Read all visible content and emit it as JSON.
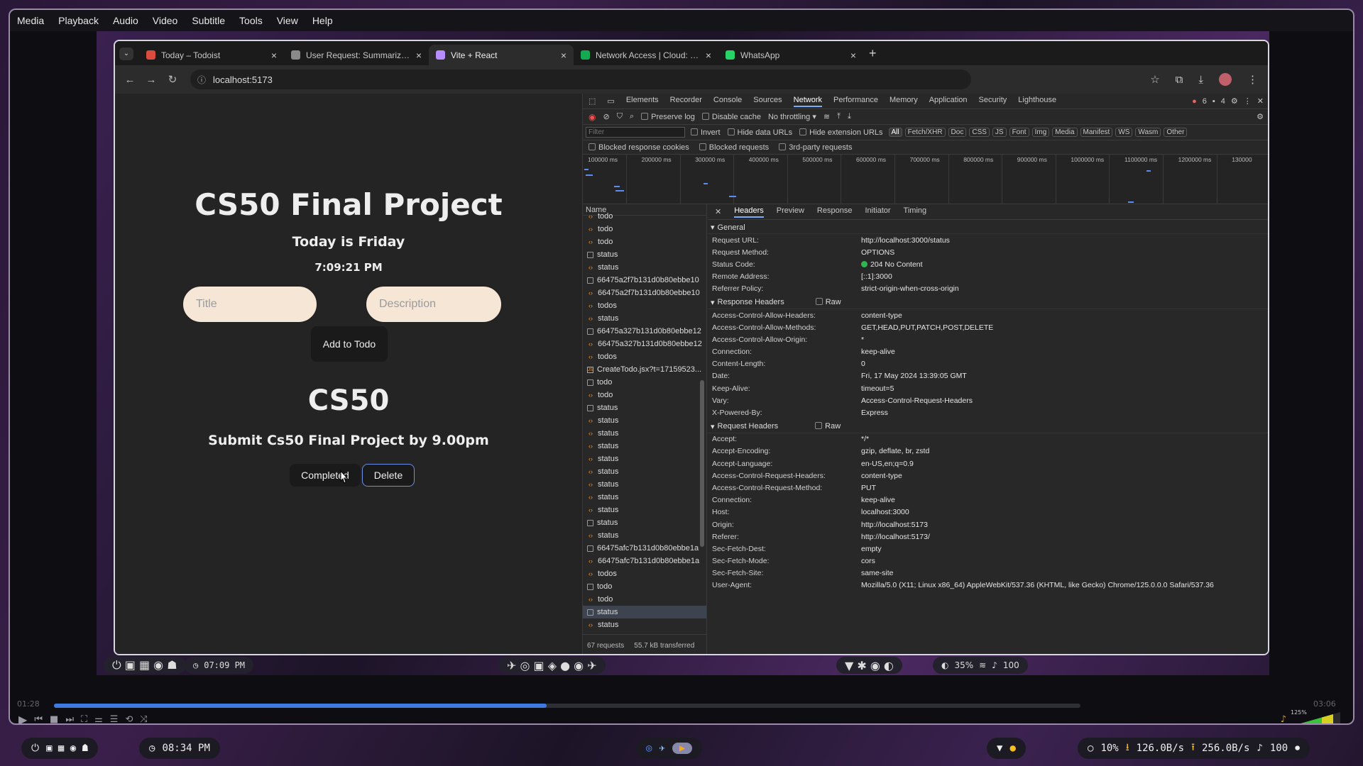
{
  "vlc": {
    "menu": [
      "Media",
      "Playback",
      "Audio",
      "Video",
      "Subtitle",
      "Tools",
      "View",
      "Help"
    ],
    "time_elapsed": "01:28",
    "time_total": "03:06",
    "progress": 0.48,
    "volume_percent": "125%",
    "inner_dock": {
      "clock": "07:09 PM",
      "brightness": "35%",
      "volume": "100"
    }
  },
  "browser": {
    "tabs": [
      {
        "title": "Today – Todoist",
        "color": "#db4c3f"
      },
      {
        "title": "User Request: Summarize Co",
        "color": "#8a8a8a"
      },
      {
        "title": "Vite + React",
        "color": "#b78cff"
      },
      {
        "title": "Network Access | Cloud: Mon",
        "color": "#13aa52"
      },
      {
        "title": "WhatsApp",
        "color": "#25d366"
      }
    ],
    "active_tab": 2,
    "url": "localhost:5173"
  },
  "page": {
    "title": "CS50 Final Project",
    "today": "Today is Friday",
    "clock": "7:09:21 PM",
    "title_placeholder": "Title",
    "description_placeholder": "Description",
    "add_button": "Add to Todo",
    "todo": {
      "title": "CS50",
      "description": "Submit Cs50 Final Project by 9.00pm",
      "completed_label": "Completed",
      "delete_label": "Delete"
    }
  },
  "devtools": {
    "panels": [
      "Elements",
      "Recorder",
      "Console",
      "Sources",
      "Network",
      "Performance",
      "Memory",
      "Application",
      "Security",
      "Lighthouse"
    ],
    "active_panel": "Network",
    "errors": "6",
    "messages": "4",
    "controls": {
      "preserve_log": "Preserve log",
      "disable_cache": "Disable cache",
      "throttling": "No throttling"
    },
    "filter_placeholder": "Filter",
    "filter_options": [
      "Invert",
      "Hide data URLs",
      "Hide extension URLs"
    ],
    "type_chips": [
      "All",
      "Fetch/XHR",
      "Doc",
      "CSS",
      "JS",
      "Font",
      "Img",
      "Media",
      "Manifest",
      "WS",
      "Wasm",
      "Other"
    ],
    "block_options": [
      "Blocked response cookies",
      "Blocked requests",
      "3rd-party requests"
    ],
    "timeline_ticks": [
      "100000 ms",
      "200000 ms",
      "300000 ms",
      "400000 ms",
      "500000 ms",
      "600000 ms",
      "700000 ms",
      "800000 ms",
      "900000 ms",
      "1000000 ms",
      "1100000 ms",
      "1200000 ms",
      "130000"
    ],
    "list_header": "Name",
    "requests": [
      {
        "name": "todo",
        "type": "xhr"
      },
      {
        "name": "todo",
        "type": "xhr"
      },
      {
        "name": "todo",
        "type": "xhr"
      },
      {
        "name": "status",
        "type": "doc"
      },
      {
        "name": "status",
        "type": "xhr"
      },
      {
        "name": "66475a2f7b131d0b80ebbe10",
        "type": "doc"
      },
      {
        "name": "66475a2f7b131d0b80ebbe10",
        "type": "xhr"
      },
      {
        "name": "todos",
        "type": "xhr"
      },
      {
        "name": "status",
        "type": "xhr"
      },
      {
        "name": "66475a327b131d0b80ebbe12",
        "type": "doc"
      },
      {
        "name": "66475a327b131d0b80ebbe12",
        "type": "xhr"
      },
      {
        "name": "todos",
        "type": "xhr"
      },
      {
        "name": "CreateTodo.jsx?t=17159523...",
        "type": "js"
      },
      {
        "name": "todo",
        "type": "doc"
      },
      {
        "name": "todo",
        "type": "xhr"
      },
      {
        "name": "status",
        "type": "doc"
      },
      {
        "name": "status",
        "type": "xhr"
      },
      {
        "name": "status",
        "type": "xhr"
      },
      {
        "name": "status",
        "type": "xhr"
      },
      {
        "name": "status",
        "type": "xhr"
      },
      {
        "name": "status",
        "type": "xhr"
      },
      {
        "name": "status",
        "type": "xhr"
      },
      {
        "name": "status",
        "type": "xhr"
      },
      {
        "name": "status",
        "type": "xhr"
      },
      {
        "name": "status",
        "type": "doc"
      },
      {
        "name": "status",
        "type": "xhr"
      },
      {
        "name": "66475afc7b131d0b80ebbe1a",
        "type": "doc"
      },
      {
        "name": "66475afc7b131d0b80ebbe1a",
        "type": "xhr"
      },
      {
        "name": "todos",
        "type": "xhr"
      },
      {
        "name": "todo",
        "type": "doc"
      },
      {
        "name": "todo",
        "type": "xhr"
      },
      {
        "name": "status",
        "type": "doc",
        "selected": true
      },
      {
        "name": "status",
        "type": "xhr"
      }
    ],
    "summary": {
      "requests": "67 requests",
      "transferred": "55.7 kB transferred"
    },
    "detail_tabs": [
      "Headers",
      "Preview",
      "Response",
      "Initiator",
      "Timing"
    ],
    "active_detail_tab": "Headers",
    "sections": {
      "general_label": "General",
      "response_label": "Response Headers",
      "request_label": "Request Headers",
      "raw_label": "Raw"
    },
    "general": [
      {
        "k": "Request URL:",
        "v": "http://localhost:3000/status"
      },
      {
        "k": "Request Method:",
        "v": "OPTIONS"
      },
      {
        "k": "Status Code:",
        "v": "204 No Content",
        "status": true
      },
      {
        "k": "Remote Address:",
        "v": "[::1]:3000"
      },
      {
        "k": "Referrer Policy:",
        "v": "strict-origin-when-cross-origin"
      }
    ],
    "response_headers": [
      {
        "k": "Access-Control-Allow-Headers:",
        "v": "content-type"
      },
      {
        "k": "Access-Control-Allow-Methods:",
        "v": "GET,HEAD,PUT,PATCH,POST,DELETE"
      },
      {
        "k": "Access-Control-Allow-Origin:",
        "v": "*"
      },
      {
        "k": "Connection:",
        "v": "keep-alive"
      },
      {
        "k": "Content-Length:",
        "v": "0"
      },
      {
        "k": "Date:",
        "v": "Fri, 17 May 2024 13:39:05 GMT"
      },
      {
        "k": "Keep-Alive:",
        "v": "timeout=5"
      },
      {
        "k": "Vary:",
        "v": "Access-Control-Request-Headers"
      },
      {
        "k": "X-Powered-By:",
        "v": "Express"
      }
    ],
    "request_headers": [
      {
        "k": "Accept:",
        "v": "*/*"
      },
      {
        "k": "Accept-Encoding:",
        "v": "gzip, deflate, br, zstd"
      },
      {
        "k": "Accept-Language:",
        "v": "en-US,en;q=0.9"
      },
      {
        "k": "Access-Control-Request-Headers:",
        "v": "content-type"
      },
      {
        "k": "Access-Control-Request-Method:",
        "v": "PUT"
      },
      {
        "k": "Connection:",
        "v": "keep-alive"
      },
      {
        "k": "Host:",
        "v": "localhost:3000"
      },
      {
        "k": "Origin:",
        "v": "http://localhost:5173"
      },
      {
        "k": "Referer:",
        "v": "http://localhost:5173/"
      },
      {
        "k": "Sec-Fetch-Dest:",
        "v": "empty"
      },
      {
        "k": "Sec-Fetch-Mode:",
        "v": "cors"
      },
      {
        "k": "Sec-Fetch-Site:",
        "v": "same-site"
      },
      {
        "k": "User-Agent:",
        "v": "Mozilla/5.0 (X11; Linux x86_64) AppleWebKit/537.36 (KHTML, like Gecko) Chrome/125.0.0.0 Safari/537.36"
      }
    ]
  },
  "host_panel": {
    "clock": "08:34 PM",
    "cpu": "10%",
    "down": "126.0B/s",
    "up": "256.0B/s",
    "volume": "100"
  }
}
